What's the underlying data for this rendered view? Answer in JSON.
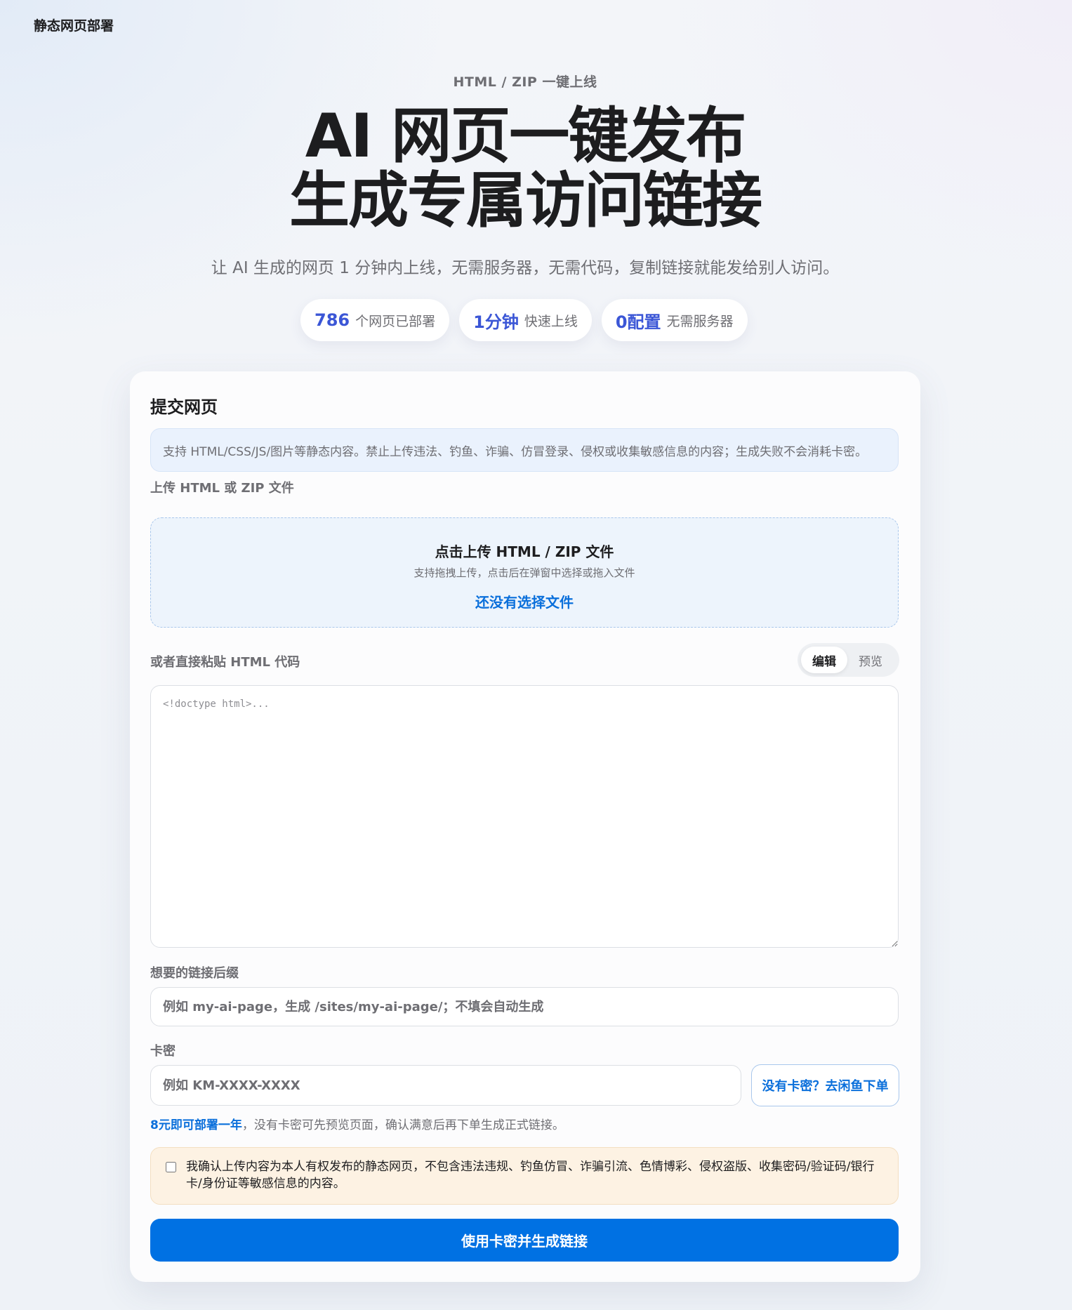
{
  "brand": "静态网页部署",
  "hero": {
    "eyebrow": "HTML / ZIP 一键上线",
    "title_line1": "AI 网页一键发布",
    "title_line2": "生成专属访问链接",
    "subtitle": "让 AI 生成的网页 1 分钟内上线，无需服务器，无需代码，复制链接就能发给别人访问。"
  },
  "stats": [
    {
      "value": "786",
      "label": "个网页已部署"
    },
    {
      "value": "1分钟",
      "label": "快速上线"
    },
    {
      "value": "0配置",
      "label": "无需服务器"
    }
  ],
  "form": {
    "title": "提交网页",
    "notice": "支持 HTML/CSS/JS/图片等静态内容。禁止上传违法、钓鱼、诈骗、仿冒登录、侵权或收集敏感信息的内容；生成失败不会消耗卡密。",
    "upload": {
      "label": "上传 HTML 或 ZIP 文件",
      "title": "点击上传 HTML / ZIP 文件",
      "hint": "支持拖拽上传，点击后在弹窗中选择或拖入文件",
      "status": "还没有选择文件"
    },
    "paste": {
      "label": "或者直接粘贴 HTML 代码",
      "tab_edit": "编辑",
      "tab_preview": "预览",
      "placeholder": "<!doctype html>..."
    },
    "slug": {
      "label": "想要的链接后缀",
      "placeholder": "例如 my-ai-page，生成 /sites/my-ai-page/；不填会自动生成"
    },
    "card_key": {
      "label": "卡密",
      "placeholder": "例如 KM-XXXX-XXXX",
      "buy_button": "没有卡密？去闲鱼下单"
    },
    "price_note": {
      "highlight": "8元即可部署一年",
      "rest": "，没有卡密可先预览页面，确认满意后再下单生成正式链接。"
    },
    "agreement": {
      "checked": false,
      "text": "我确认上传内容为本人有权发布的静态网页，不包含违法违规、钓鱼仿冒、诈骗引流、色情博彩、侵权盗版、收集密码/验证码/银行卡/身份证等敏感信息的内容。"
    },
    "submit_label": "使用卡密并生成链接"
  },
  "colors": {
    "accent": "#0071e3",
    "link": "#0a6fdb",
    "stat_number": "#3b56d6",
    "notice_bg": "#eaf2fd",
    "agreement_bg": "#fdf2e3"
  }
}
